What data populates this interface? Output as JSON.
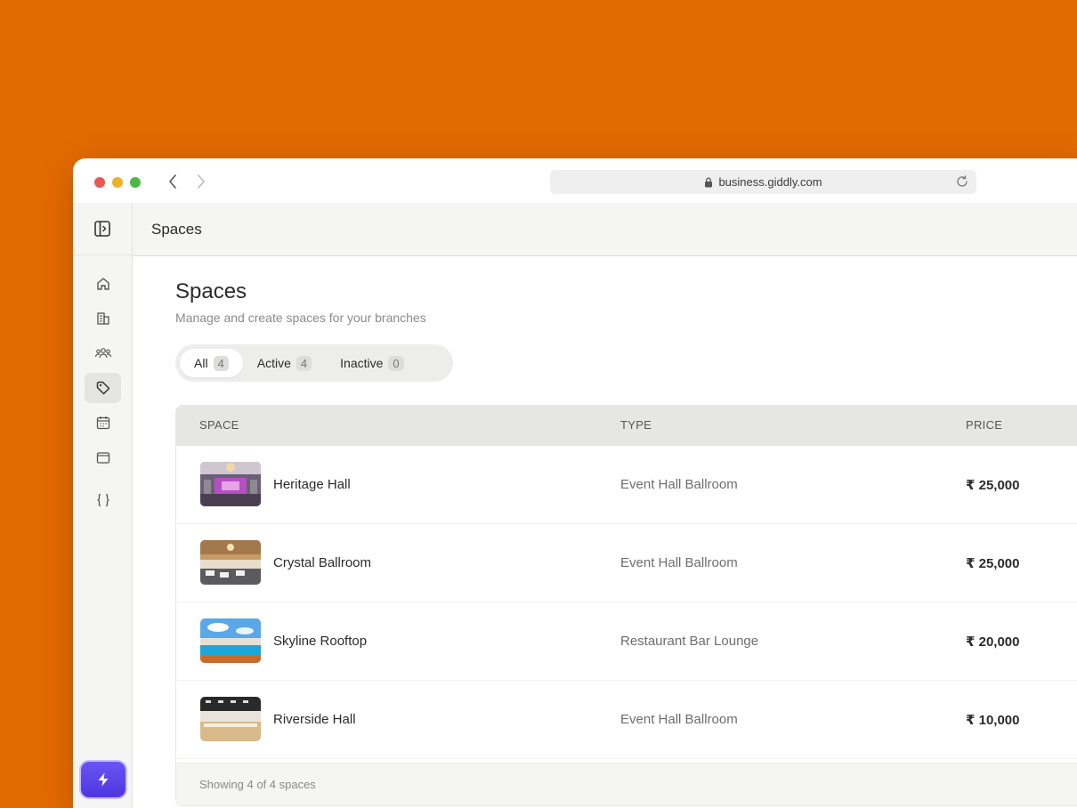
{
  "browser": {
    "url": "business.giddly.com"
  },
  "header": {
    "title": "Spaces"
  },
  "sidebar": {
    "items": [
      {
        "icon": "home-icon"
      },
      {
        "icon": "building-icon"
      },
      {
        "icon": "users-icon"
      },
      {
        "icon": "tag-icon",
        "active": true
      },
      {
        "icon": "calendar-icon"
      },
      {
        "icon": "wallet-icon"
      },
      {
        "icon": "braces-icon"
      }
    ],
    "accent": "#5B43EA"
  },
  "main": {
    "title": "Spaces",
    "subtitle": "Manage and create spaces for your branches",
    "tabs": [
      {
        "label": "All",
        "count": "4",
        "active": true
      },
      {
        "label": "Active",
        "count": "4"
      },
      {
        "label": "Inactive",
        "count": "0"
      }
    ],
    "table": {
      "columns": [
        "SPACE",
        "TYPE",
        "PRICE"
      ],
      "rows": [
        {
          "name": "Heritage Hall",
          "type": "Event Hall Ballroom",
          "price": "₹ 25,000"
        },
        {
          "name": "Crystal Ballroom",
          "type": "Event Hall Ballroom",
          "price": "₹ 25,000"
        },
        {
          "name": "Skyline Rooftop",
          "type": "Restaurant Bar Lounge",
          "price": "₹ 20,000"
        },
        {
          "name": "Riverside Hall",
          "type": "Event Hall Ballroom",
          "price": "₹ 10,000"
        }
      ],
      "footer": "Showing 4 of 4 spaces"
    }
  },
  "colors": {
    "background": "#E36A00",
    "sidebar": "#F5F5F4"
  }
}
